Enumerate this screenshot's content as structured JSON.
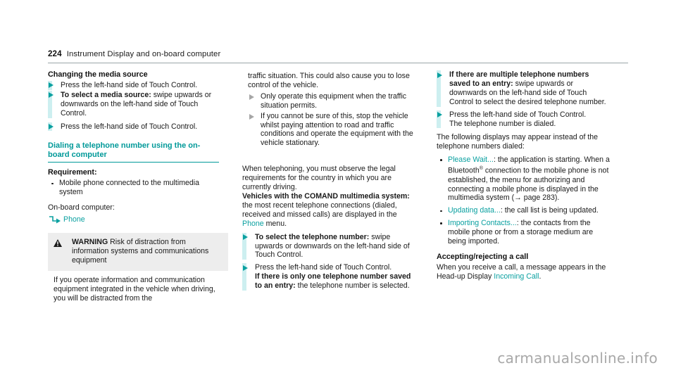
{
  "header": {
    "folio": "224",
    "chapter": "Instrument Display and on-board computer"
  },
  "col1": {
    "heading_media": "Changing the media source",
    "step_1": "Press the left-hand side of Touch Control.",
    "step_2_bold": "To select a media source:",
    "step_2_rest": " swipe upwards or downwards on the left-hand side of Touch Control.",
    "step_3": "Press the left-hand side of Touch Control.",
    "heading_dialing": "Dialing a telephone number using the on-board computer",
    "requirement_label": "Requirement:",
    "requirement_item": "Mobile phone connected to the multimedia system",
    "obc_label": "On-board computer:",
    "obc_path": "Phone",
    "warning_label": "WARNING",
    "warning_title": " Risk of distraction from information systems and communications equipment",
    "warning_body": "If you operate information and communication equipment integrated in the vehicle when driving, you will be distracted from the"
  },
  "col2": {
    "warning_cont": "traffic situation. This could also cause you to lose control of the vehicle.",
    "warn_step_1": "Only operate this equipment when the traffic situation permits.",
    "warn_step_2": "If you cannot be sure of this, stop the vehicle whilst paying attention to road and traffic conditions and operate the equipment with the vehicle stationary.",
    "para_legal": "When telephoning, you must observe the legal requirements for the country in which you are currently driving.",
    "comand_bold": "Vehicles with the COMAND multimedia system:",
    "comand_rest_a": " the most recent telephone connections (dialed, received and missed calls) are displayed in the ",
    "comand_link": "Phone",
    "comand_rest_b": " menu.",
    "step_select_bold": "To select the telephone number:",
    "step_select_rest": " swipe upwards or downwards on the left-hand side of Touch Control.",
    "step_press_plain": "Press the left-hand side of Touch Control.",
    "step_press_bold": "If there is only one telephone number saved to an entry:",
    "step_press_rest": " the telephone number is selected."
  },
  "col3": {
    "step_multi_bold": "If there are multiple telephone numbers saved to an entry:",
    "step_multi_rest": " swipe upwards or downwards on the left-hand side of Touch Control to select the desired telephone number.",
    "step_press_1": "Press the left-hand side of Touch Control.",
    "step_press_2": "The telephone number is dialed.",
    "para_following": "The following displays may appear instead of the telephone numbers dialed:",
    "bullet1_link": "Please Wait...",
    "bullet1_rest": ": the application is starting. When a Bluetooth",
    "bullet1_sup": "®",
    "bullet1_rest2": " connection to the mobile phone is not established, the menu for authorizing and connecting a mobile phone is displayed in the multimedia system (→ page 283).",
    "bullet2_link": "Updating data...",
    "bullet2_rest": ": the call list is being updated.",
    "bullet3_link": "Importing Contacts...",
    "bullet3_rest": ": the contacts from the mobile phone or from a storage medium are being imported.",
    "heading_accept": "Accepting/rejecting a call",
    "accept_body_a": "When you receive a call, a message appears in the Head-up Display ",
    "accept_link": "Incoming Call",
    "accept_body_b": "."
  },
  "footer": {
    "watermark": "carmanualsonline.info"
  },
  "colors": {
    "teal": "#0aa0a0",
    "teal_head": "#009999",
    "step_bar": "#cdeff0",
    "warn_bg": "#ededed",
    "rule": "#9aa6a8"
  }
}
